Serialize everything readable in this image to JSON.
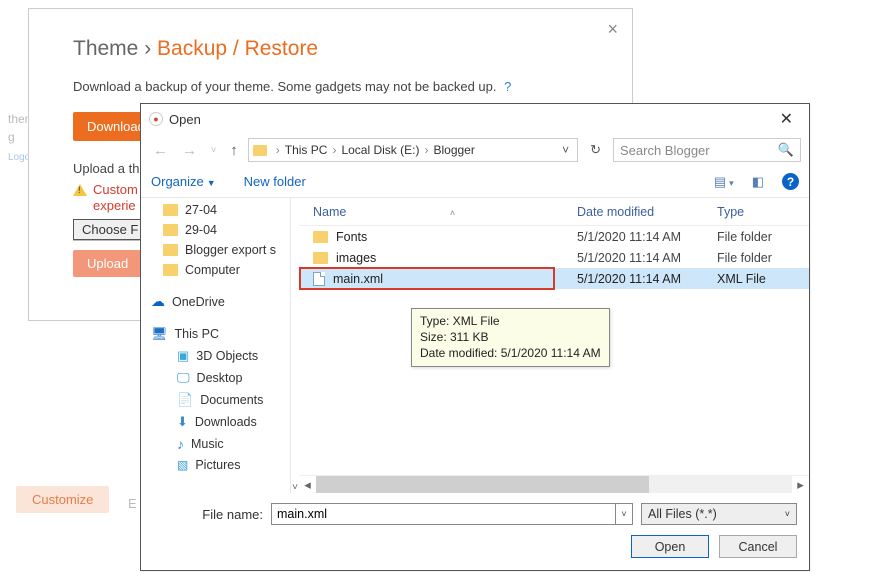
{
  "bg": {
    "sidebar_text": "them",
    "sidebar_g": "g",
    "logo": "Logo",
    "customize": "Customize",
    "e": "E"
  },
  "backup": {
    "title_prefix": "Theme  ›  ",
    "title_accent": "Backup / Restore",
    "desc": "Download a backup of your theme. Some gadgets may not be backed up.",
    "help": "?",
    "download": "Download",
    "upload_label": "Upload a th",
    "warn_l1": "Custom",
    "warn_l2": "experie",
    "choose_file": "Choose F",
    "upload": "Upload"
  },
  "open": {
    "title": "Open",
    "breadcrumb": [
      "This PC",
      "Local Disk (E:)",
      "Blogger"
    ],
    "search_placeholder": "Search Blogger",
    "organize": "Organize",
    "new_folder": "New folder",
    "columns": {
      "name": "Name",
      "date": "Date modified",
      "type": "Type"
    },
    "tree": {
      "folders": [
        "27-04",
        "29-04",
        "Blogger export s",
        "Computer"
      ],
      "onedrive": "OneDrive",
      "thispc": "This PC",
      "pc_items": [
        "3D Objects",
        "Desktop",
        "Documents",
        "Downloads",
        "Music",
        "Pictures"
      ]
    },
    "rows": [
      {
        "name": "Fonts",
        "date": "5/1/2020 11:14 AM",
        "type": "File folder",
        "kind": "folder"
      },
      {
        "name": "images",
        "date": "5/1/2020 11:14 AM",
        "type": "File folder",
        "kind": "folder"
      },
      {
        "name": "main.xml",
        "date": "5/1/2020 11:14 AM",
        "type": "XML File",
        "kind": "file",
        "selected": true
      }
    ],
    "tooltip": {
      "l1": "Type: XML File",
      "l2": "Size: 311 KB",
      "l3": "Date modified: 5/1/2020 11:14 AM"
    },
    "filename_label": "File name:",
    "filename_value": "main.xml",
    "filter": "All Files (*.*)",
    "open_btn": "Open",
    "cancel_btn": "Cancel"
  }
}
